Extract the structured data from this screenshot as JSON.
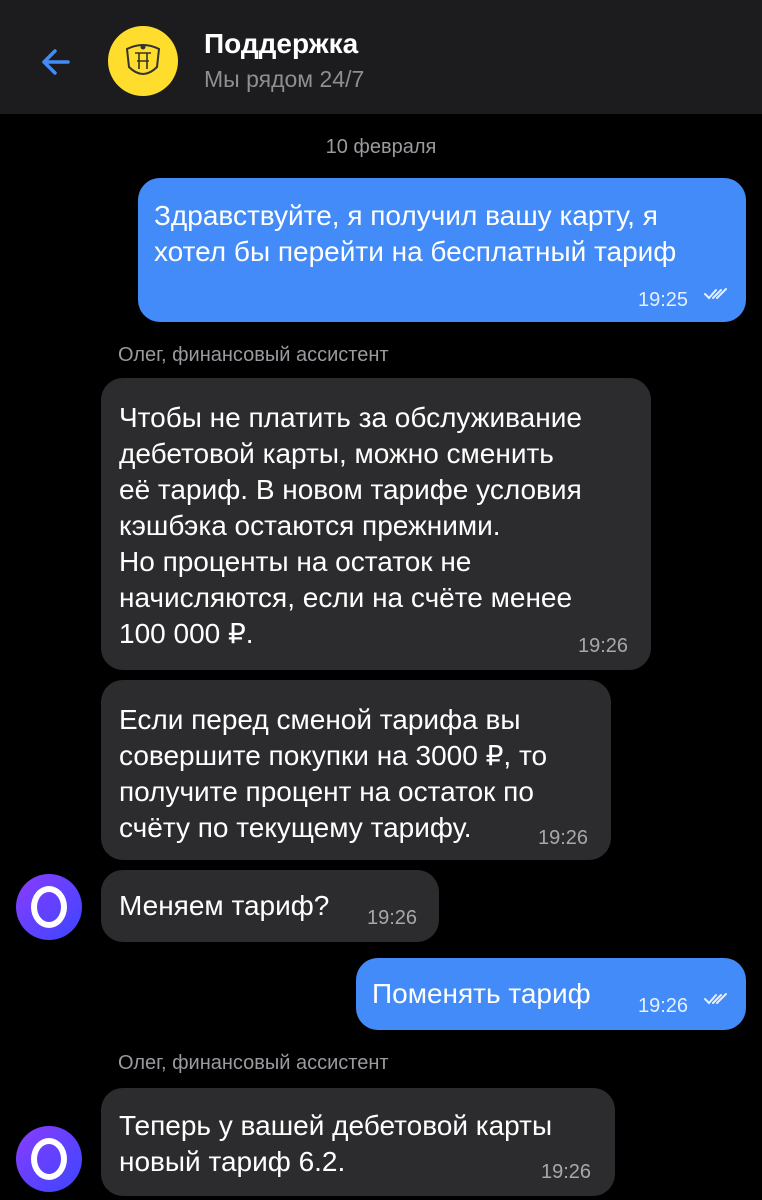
{
  "header": {
    "title": "Поддержка",
    "subtitle": "Мы рядом 24/7"
  },
  "chat": {
    "date_separator": "10 февраля",
    "messages": [
      {
        "direction": "out",
        "text": "Здравствуйте, я получил вашу карту, я\nхотел бы перейти на бесплатный тариф",
        "time": "19:25",
        "status": "read"
      },
      {
        "direction": "in",
        "sender": "Олег, финансовый ассистент",
        "text": "Чтобы не платить за обслуживание\nдебетовой карты, можно сменить\nеё тариф. В новом тарифе условия\nкэшбэка остаются прежними.\nНо проценты на остаток не\nначисляются, если на счёте менее\n100 000 ₽.",
        "time": "19:26"
      },
      {
        "direction": "in",
        "text": "Если перед сменой тарифа вы\nсовершите покупки на 3000 ₽, то\nполучите процент на остаток по\nсчёту по текущему тарифу.",
        "time": "19:26"
      },
      {
        "direction": "in",
        "text": "Меняем тариф?",
        "time": "19:26"
      },
      {
        "direction": "out",
        "text": "Поменять тариф",
        "time": "19:26",
        "status": "read"
      },
      {
        "direction": "in",
        "sender": "Олег, финансовый ассистент",
        "text": "Теперь у вашей дебетовой карты\nновый тариф 6.2.",
        "time": "19:26"
      }
    ]
  },
  "icons": {
    "back": "arrow-left-icon",
    "read_status": "double-check-icon",
    "bank_logo": "tinkoff-logo",
    "assistant": "assistant-avatar-o"
  },
  "colors": {
    "outgoing_bubble": "#428bf9",
    "incoming_bubble": "#2c2c2e",
    "header_bg": "#1c1c1e",
    "background": "#000000",
    "logo_yellow": "#ffdd2d",
    "back_arrow": "#428bf9"
  }
}
